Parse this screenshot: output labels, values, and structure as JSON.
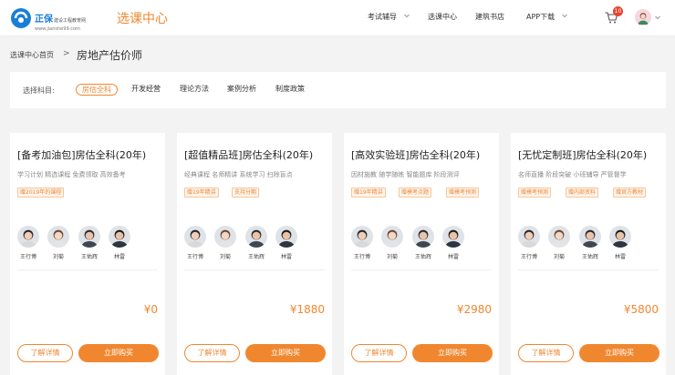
{
  "header": {
    "logo_name": "正保",
    "logo_tagline": "建设工程教育网",
    "logo_url": "www.jianshe99.com",
    "app_title": "选课中心",
    "nav": [
      {
        "label": "考试辅导",
        "dropdown": true
      },
      {
        "label": "选课中心",
        "dropdown": false
      },
      {
        "label": "建筑书店",
        "dropdown": false
      },
      {
        "label": "APP下载",
        "dropdown": true
      }
    ],
    "cart_count": "10",
    "accent_color": "#f0872f"
  },
  "breadcrumb": {
    "home": "选课中心首页",
    "separator": ">",
    "current": "房地产估价师"
  },
  "filter": {
    "label": "选择科目:",
    "options": [
      "房估全科",
      "开发经营",
      "理论方法",
      "案例分析",
      "制度政策"
    ],
    "active": "房估全科"
  },
  "cards": [
    {
      "title": "[备考加油包]房估全科(20年)",
      "desc": "学习计划 精选课程 免费领取 高效备考",
      "tags": [
        "赠2019年的课程"
      ],
      "teachers": [
        "王行博",
        "刘菊",
        "王佑辉",
        "林雷"
      ],
      "price": "¥0",
      "detail_label": "了解详情",
      "buy_label": "立即购买"
    },
    {
      "title": "[超值精品班]房估全科(20年)",
      "desc": "经典课程 名师精讲 系统学习 扫除盲点",
      "tags": [
        "赠19年精讲",
        "支持分期"
      ],
      "teachers": [
        "王行博",
        "刘菊",
        "王佑辉",
        "林雷"
      ],
      "price": "¥1880",
      "detail_label": "了解详情",
      "buy_label": "立即购买"
    },
    {
      "title": "[高效实验班]房估全科(20年)",
      "desc": "因材施教 随学随练 智能题库 阶段测评",
      "tags": [
        "赠19年精讲",
        "赠模考点题",
        "赠模考预测"
      ],
      "teachers": [
        "王行博",
        "刘菊",
        "王佑辉",
        "林雷"
      ],
      "price": "¥2980",
      "detail_label": "了解详情",
      "buy_label": "立即购买"
    },
    {
      "title": "[无忧定制班]房估全科(20年)",
      "desc": "名师直播 阶段突破 小班辅导 严管督学",
      "tags": [
        "赠模考预测",
        "赠内部资料",
        "赠官方教材"
      ],
      "teachers": [
        "王行博",
        "刘菊",
        "王佑辉",
        "林雷"
      ],
      "price": "¥5800",
      "detail_label": "了解详情",
      "buy_label": "立即购买"
    }
  ]
}
